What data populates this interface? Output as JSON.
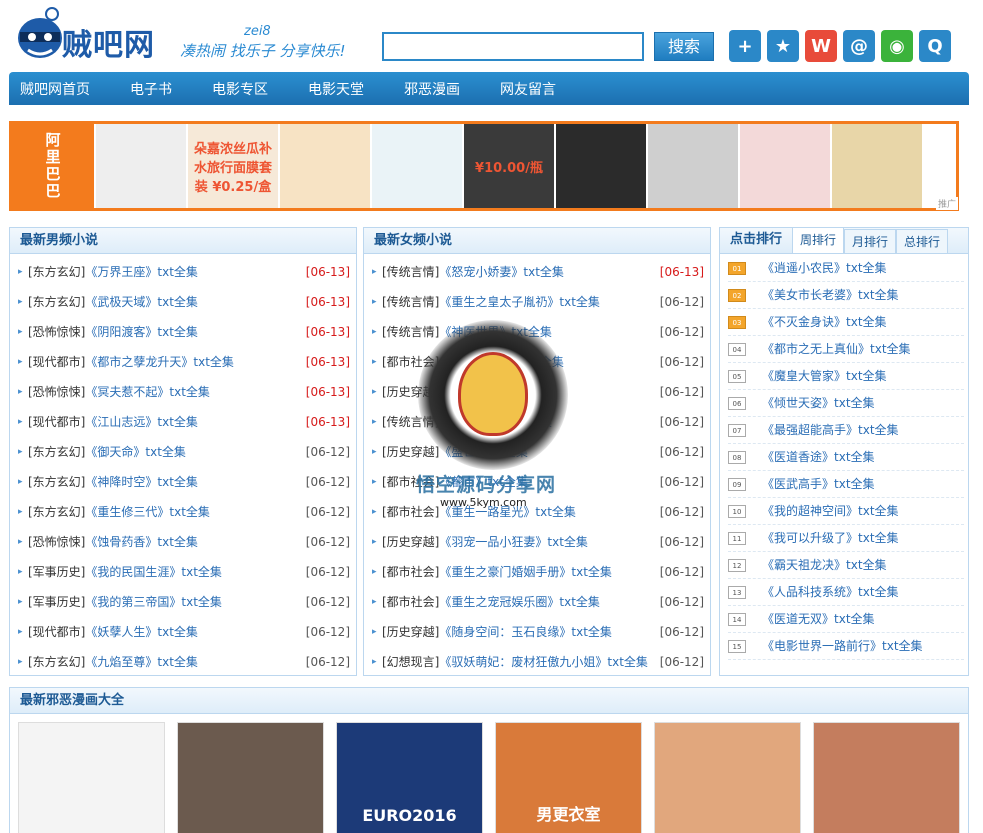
{
  "header": {
    "logo_text": "贼吧网",
    "slogan_top": "zei8",
    "slogan": "凑热闹 找乐子 分享快乐!",
    "search_placeholder": "",
    "search_button": "搜索",
    "share_icons": [
      {
        "name": "plus-share-icon",
        "glyph": "+",
        "color": "#2b88c8"
      },
      {
        "name": "star-share-icon",
        "glyph": "★",
        "color": "#2b88c8"
      },
      {
        "name": "weibo-share-icon",
        "glyph": "W",
        "color": "#e84b3a"
      },
      {
        "name": "tencent-weibo-share-icon",
        "glyph": "@",
        "color": "#2b88c8"
      },
      {
        "name": "wechat-share-icon",
        "glyph": "◉",
        "color": "#3bb33b"
      },
      {
        "name": "qq-share-icon",
        "glyph": "Q",
        "color": "#2b88c8"
      }
    ]
  },
  "nav": {
    "items": [
      "贼吧网首页",
      "电子书",
      "电影专区",
      "电影天堂",
      "邪恶漫画",
      "网友留言"
    ]
  },
  "banner": {
    "label": "阿里巴巴",
    "items": [
      "",
      "朵嘉浓丝瓜补水旅行面膜套装 ¥0.25/盒",
      "",
      "",
      "¥10.00/瓶",
      "",
      "",
      "",
      ""
    ],
    "tag": "推广"
  },
  "male_novels": {
    "title": "最新男频小说",
    "items": [
      {
        "cat": "[东方玄幻]",
        "title": "《万界王座》",
        "txt": "txt全集",
        "date": "[06-13]",
        "new": true
      },
      {
        "cat": "[东方玄幻]",
        "title": "《武极天域》",
        "txt": "txt全集",
        "date": "[06-13]",
        "new": true
      },
      {
        "cat": "[恐怖惊悚]",
        "title": "《阴阳渡客》",
        "txt": "txt全集",
        "date": "[06-13]",
        "new": true
      },
      {
        "cat": "[现代都市]",
        "title": "《都市之孽龙升天》",
        "txt": "txt全集",
        "date": "[06-13]",
        "new": true
      },
      {
        "cat": "[恐怖惊悚]",
        "title": "《冥夫惹不起》",
        "txt": "txt全集",
        "date": "[06-13]",
        "new": true
      },
      {
        "cat": "[现代都市]",
        "title": "《江山志远》",
        "txt": "txt全集",
        "date": "[06-13]",
        "new": true
      },
      {
        "cat": "[东方玄幻]",
        "title": "《御天命》",
        "txt": "txt全集",
        "date": "[06-12]",
        "new": false
      },
      {
        "cat": "[东方玄幻]",
        "title": "《神降时空》",
        "txt": "txt全集",
        "date": "[06-12]",
        "new": false
      },
      {
        "cat": "[东方玄幻]",
        "title": "《重生修三代》",
        "txt": "txt全集",
        "date": "[06-12]",
        "new": false
      },
      {
        "cat": "[恐怖惊悚]",
        "title": "《蚀骨药香》",
        "txt": "txt全集",
        "date": "[06-12]",
        "new": false
      },
      {
        "cat": "[军事历史]",
        "title": "《我的民国生涯》",
        "txt": "txt全集",
        "date": "[06-12]",
        "new": false
      },
      {
        "cat": "[军事历史]",
        "title": "《我的第三帝国》",
        "txt": "txt全集",
        "date": "[06-12]",
        "new": false
      },
      {
        "cat": "[现代都市]",
        "title": "《妖孽人生》",
        "txt": "txt全集",
        "date": "[06-12]",
        "new": false
      },
      {
        "cat": "[东方玄幻]",
        "title": "《九焰至尊》",
        "txt": "txt全集",
        "date": "[06-12]",
        "new": false
      }
    ]
  },
  "female_novels": {
    "title": "最新女频小说",
    "items": [
      {
        "cat": "[传统言情]",
        "title": "《怒宠小娇妻》",
        "txt": "txt全集",
        "date": "[06-13]",
        "new": true
      },
      {
        "cat": "[传统言情]",
        "title": "《重生之皇太子胤礽》",
        "txt": "txt全集",
        "date": "[06-12]",
        "new": false
      },
      {
        "cat": "[传统言情]",
        "title": "《神医世界》",
        "txt": "txt全集",
        "date": "[06-12]",
        "new": false
      },
      {
        "cat": "[都市社会]",
        "title": "《天天宅一起》",
        "txt": "txt全集",
        "date": "[06-12]",
        "new": false
      },
      {
        "cat": "[历史穿越]",
        "title": "《翔王爷》",
        "txt": "txt全集",
        "date": "[06-12]",
        "new": false
      },
      {
        "cat": "[传统言情]",
        "title": "《重生之王》",
        "txt": "txt全集",
        "date": "[06-12]",
        "new": false
      },
      {
        "cat": "[历史穿越]",
        "title": "《盛世》",
        "txt": "txt全集",
        "date": "[06-12]",
        "new": false
      },
      {
        "cat": "[都市社会]",
        "title": "《都市》",
        "txt": "txt全集",
        "date": "[06-12]",
        "new": false
      },
      {
        "cat": "[都市社会]",
        "title": "《重生一路星光》",
        "txt": "txt全集",
        "date": "[06-12]",
        "new": false
      },
      {
        "cat": "[历史穿越]",
        "title": "《羽宠一品小狂妻》",
        "txt": "txt全集",
        "date": "[06-12]",
        "new": false
      },
      {
        "cat": "[都市社会]",
        "title": "《重生之豪门婚姻手册》",
        "txt": "txt全集",
        "date": "[06-12]",
        "new": false
      },
      {
        "cat": "[都市社会]",
        "title": "《重生之宠冠娱乐圈》",
        "txt": "txt全集",
        "date": "[06-12]",
        "new": false
      },
      {
        "cat": "[历史穿越]",
        "title": "《随身空间：玉石良缘》",
        "txt": "txt全集",
        "date": "[06-12]",
        "new": false
      },
      {
        "cat": "[幻想现言]",
        "title": "《驭妖萌妃：废材狂傲九小姐》",
        "txt": "txt全集",
        "date": "[06-12]",
        "new": false
      }
    ]
  },
  "ranking": {
    "title": "点击排行",
    "tabs": [
      "周排行",
      "月排行",
      "总排行"
    ],
    "items": [
      {
        "num": "01",
        "name": "《逍遥小农民》",
        "txt": "txt全集"
      },
      {
        "num": "02",
        "name": "《美女市长老婆》",
        "txt": "txt全集"
      },
      {
        "num": "03",
        "name": "《不灭金身诀》",
        "txt": "txt全集"
      },
      {
        "num": "04",
        "name": "《都市之无上真仙》",
        "txt": "txt全集"
      },
      {
        "num": "05",
        "name": "《魔皇大管家》",
        "txt": "txt全集"
      },
      {
        "num": "06",
        "name": "《倾世天姿》",
        "txt": "txt全集"
      },
      {
        "num": "07",
        "name": "《最强超能高手》",
        "txt": "txt全集"
      },
      {
        "num": "08",
        "name": "《医道香途》",
        "txt": "txt全集"
      },
      {
        "num": "09",
        "name": "《医武高手》",
        "txt": "txt全集"
      },
      {
        "num": "10",
        "name": "《我的超神空间》",
        "txt": "txt全集"
      },
      {
        "num": "11",
        "name": "《我可以升级了》",
        "txt": "txt全集"
      },
      {
        "num": "12",
        "name": "《霸天祖龙决》",
        "txt": "txt全集"
      },
      {
        "num": "13",
        "name": "《人品科技系统》",
        "txt": "txt全集"
      },
      {
        "num": "14",
        "name": "《医道无双》",
        "txt": "txt全集"
      },
      {
        "num": "15",
        "name": "《电影世界一路前行》",
        "txt": "txt全集"
      }
    ]
  },
  "comics": {
    "title": "最新邪恶漫画大全",
    "thumbs": [
      {
        "name": "comic-thumb-meme",
        "color": "#f4f4f4",
        "label": ""
      },
      {
        "name": "comic-thumb-photo",
        "color": "#6b5a4e",
        "label": ""
      },
      {
        "name": "comic-thumb-euro",
        "color": "#1c3a78",
        "label": "EURO2016"
      },
      {
        "name": "comic-thumb-locker",
        "color": "#d97a3a",
        "label": "男更衣室"
      },
      {
        "name": "comic-thumb-leg",
        "color": "#e1a77d",
        "label": ""
      },
      {
        "name": "comic-thumb-portrait",
        "color": "#c47d5e",
        "label": ""
      }
    ]
  },
  "watermark": {
    "text": "悟空源码分享网",
    "url": "www.5kym.com"
  }
}
